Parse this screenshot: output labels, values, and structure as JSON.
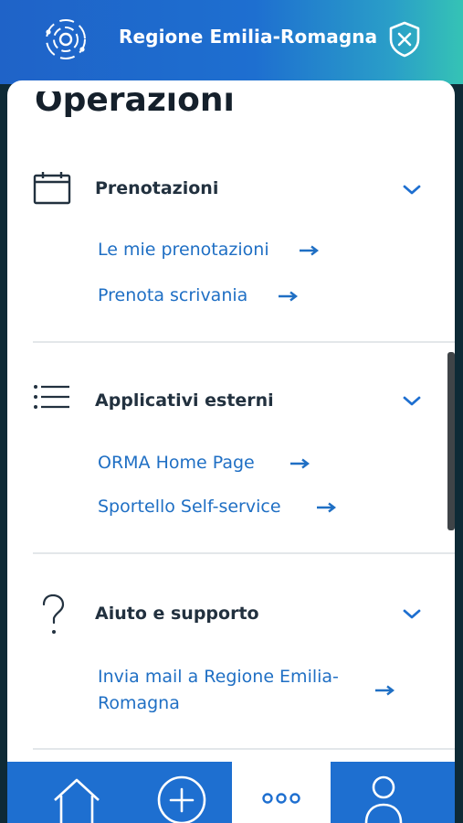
{
  "header": {
    "title": "Regione Emilia-Romagna",
    "logo_icon": "orbit-logo-icon",
    "shield_icon": "shield-close-icon"
  },
  "page": {
    "title": "Operazioni"
  },
  "sections": [
    {
      "title": "Prenotazioni",
      "icon": "calendar-icon",
      "links": [
        "Le mie prenotazioni",
        "Prenota scrivania"
      ]
    },
    {
      "title": "Applicativi esterni",
      "icon": "list-icon",
      "links": [
        "ORMA Home Page",
        "Sportello Self-service"
      ]
    },
    {
      "title": "Aiuto e supporto",
      "icon": "question-icon",
      "links": [
        "Invia mail a Regione Emilia-",
        "Romagna"
      ]
    }
  ],
  "bottom_nav": {
    "items": [
      "home-icon",
      "add-icon",
      "more-icon",
      "user-icon"
    ],
    "active": "more-icon"
  },
  "colors": {
    "accent": "#1e6fd0",
    "link": "#1f6fc4",
    "text": "#22313f"
  }
}
